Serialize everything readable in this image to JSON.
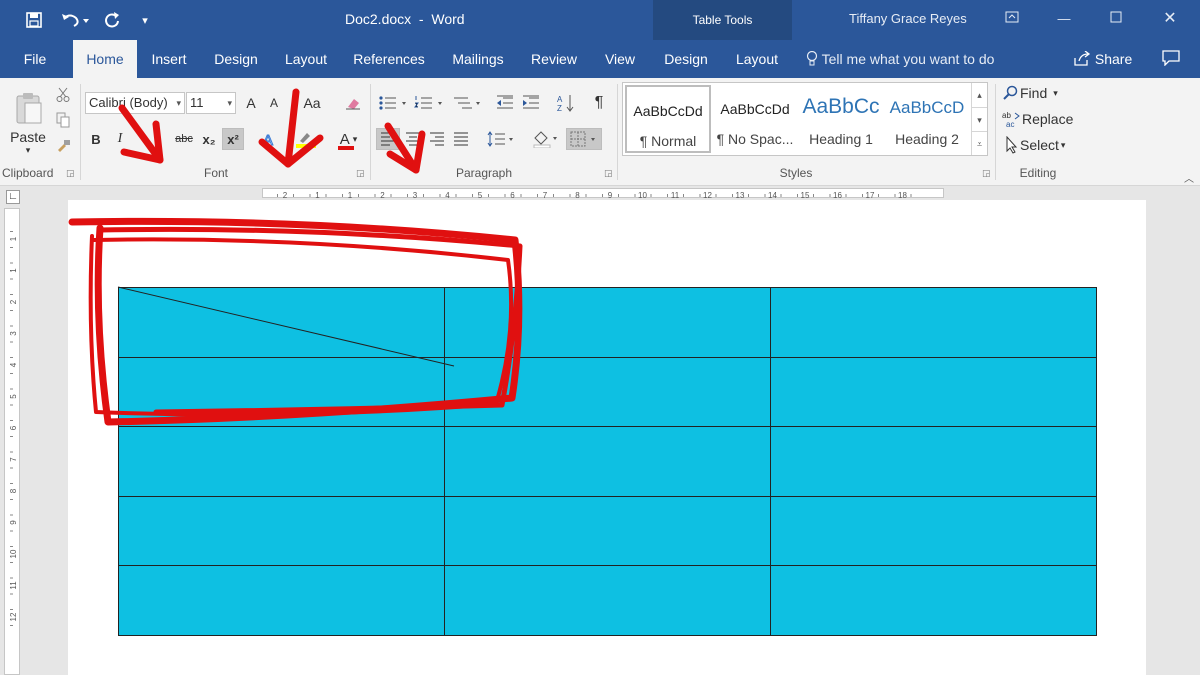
{
  "window": {
    "doc_title": "Doc2.docx  -  Word",
    "context_label": "Table Tools",
    "user": "Tiffany Grace Reyes",
    "qat_icons": [
      "save-icon",
      "undo-icon",
      "redo-icon",
      "customize-icon"
    ]
  },
  "tabs": [
    {
      "label": "File"
    },
    {
      "label": "Home"
    },
    {
      "label": "Insert"
    },
    {
      "label": "Design"
    },
    {
      "label": "Layout"
    },
    {
      "label": "References"
    },
    {
      "label": "Mailings"
    },
    {
      "label": "Review"
    },
    {
      "label": "View"
    },
    {
      "label": "Design"
    },
    {
      "label": "Layout"
    }
  ],
  "active_tab": "Home",
  "tell_me": "Tell me what you want to do",
  "share": "Share",
  "ribbon": {
    "clipboard": {
      "label": "Clipboard",
      "paste": "Paste"
    },
    "font": {
      "label": "Font",
      "font_name": "Calibri (Body)",
      "font_size": "11",
      "grow": "A",
      "shrink": "A",
      "change_case": "Aa",
      "bold": "B",
      "italic": "I",
      "strike": "abc",
      "subscript": "x₂",
      "superscript": "x²",
      "font_color": "A"
    },
    "paragraph": {
      "label": "Paragraph",
      "pilcrow": "¶"
    },
    "styles": {
      "label": "Styles",
      "items": [
        {
          "sample": "AaBbCcDd",
          "name": "¶ Normal"
        },
        {
          "sample": "AaBbCcDd",
          "name": "¶ No Spac..."
        },
        {
          "sample": "AaBbCc",
          "name": "Heading 1"
        },
        {
          "sample": "AaBbCcD",
          "name": "Heading 2"
        }
      ]
    },
    "editing": {
      "label": "Editing",
      "find": "Find",
      "replace": "Replace",
      "select": "Select"
    }
  },
  "ruler": {
    "horizontal": [
      "2",
      "1",
      "1",
      "2",
      "3",
      "4",
      "5",
      "6",
      "7",
      "8",
      "9",
      "10",
      "11",
      "12",
      "13",
      "14",
      "15",
      "16",
      "17",
      "18"
    ],
    "vertical": [
      "1",
      "1",
      "2",
      "3",
      "4",
      "5",
      "6",
      "7",
      "8",
      "9",
      "10",
      "11",
      "12"
    ]
  },
  "table": {
    "rows": 5,
    "cols": 3,
    "fill": "#0ec0e2"
  },
  "colors": {
    "titlebar": "#2b579a",
    "annotation": "#e01010",
    "table_fill": "#0ec0e2"
  }
}
